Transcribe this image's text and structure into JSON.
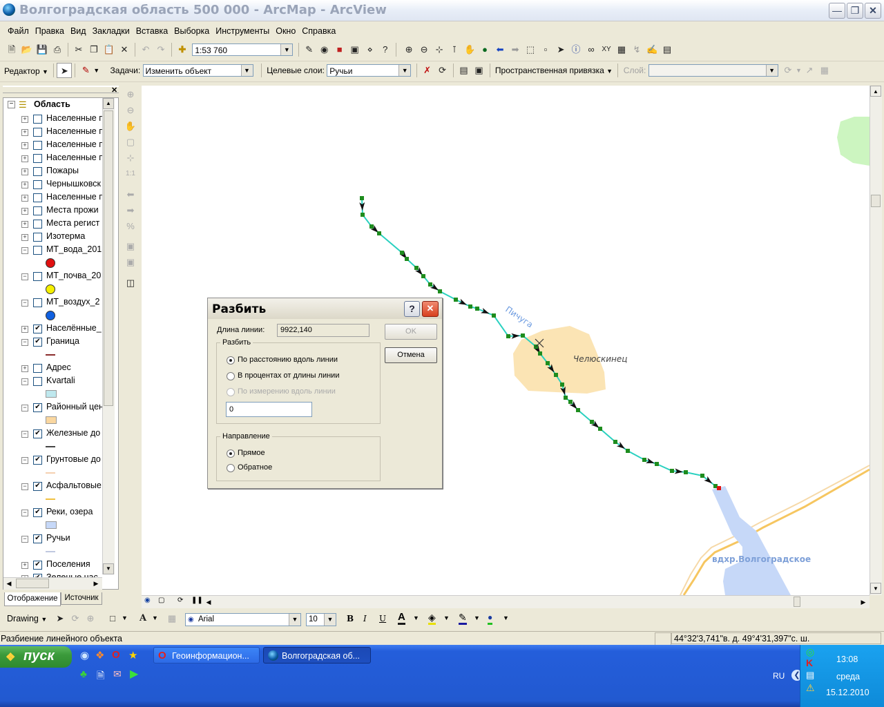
{
  "window": {
    "title": "Волгоградская область 500 000 - ArcMap - ArcView"
  },
  "menu": [
    "Файл",
    "Правка",
    "Вид",
    "Закладки",
    "Вставка",
    "Выборка",
    "Инструменты",
    "Окно",
    "Справка"
  ],
  "standard_toolbar": {
    "scale": "1:53 760"
  },
  "editor_toolbar": {
    "editor_label": "Редактор",
    "task_label": "Задачи:",
    "task_value": "Изменить объект",
    "target_label": "Целевые слои:",
    "target_value": "Ручьи",
    "snapping_label": "Пространственная привязка",
    "layer_label": "Слой:"
  },
  "toc": {
    "root": "Область",
    "layers": [
      {
        "label": "Населенные п",
        "checked": false,
        "expanded": false
      },
      {
        "label": "Населенные п",
        "checked": false,
        "expanded": false
      },
      {
        "label": "Населенные п",
        "checked": false,
        "expanded": false
      },
      {
        "label": "Населенные п",
        "checked": false,
        "expanded": false
      },
      {
        "label": "Пожары",
        "checked": false,
        "expanded": false
      },
      {
        "label": "Чернышковск",
        "checked": false,
        "expanded": false
      },
      {
        "label": "Населенные п",
        "checked": false,
        "expanded": false
      },
      {
        "label": "Места прожи",
        "checked": false,
        "expanded": false
      },
      {
        "label": "Места регист",
        "checked": false,
        "expanded": false
      },
      {
        "label": "Изотерма",
        "checked": false,
        "expanded": false
      },
      {
        "label": "МТ_вода_201",
        "checked": false,
        "expanded": true,
        "symbol": "circle",
        "color": "#e01010"
      },
      {
        "label": "МТ_почва_20",
        "checked": false,
        "expanded": true,
        "symbol": "circle",
        "color": "#f5f000"
      },
      {
        "label": "МТ_воздух_2",
        "checked": false,
        "expanded": true,
        "symbol": "circle",
        "color": "#1060e0"
      },
      {
        "label": "Населённые_",
        "checked": true,
        "expanded": false
      },
      {
        "label": "Граница",
        "checked": true,
        "expanded": true,
        "symbol": "line",
        "color": "#8a2b2b"
      },
      {
        "label": "Адрес",
        "checked": false,
        "expanded": false
      },
      {
        "label": "Kvartali",
        "checked": false,
        "expanded": true,
        "symbol": "rect",
        "color": "#bfe8ee"
      },
      {
        "label": "Районный цен",
        "checked": true,
        "expanded": true,
        "symbol": "rect",
        "color": "#fad7a0"
      },
      {
        "label": "Железные до",
        "checked": true,
        "expanded": true,
        "symbol": "line",
        "color": "#444444"
      },
      {
        "label": "Грунтовые до",
        "checked": true,
        "expanded": true,
        "symbol": "line",
        "color": "#f5d0b0"
      },
      {
        "label": "Асфальтовые",
        "checked": true,
        "expanded": true,
        "symbol": "line",
        "color": "#f0c040"
      },
      {
        "label": "Реки, озера",
        "checked": true,
        "expanded": true,
        "symbol": "rect",
        "color": "#c6d8f8"
      },
      {
        "label": "Ручьи",
        "checked": true,
        "expanded": true,
        "symbol": "line",
        "color": "#c0c8e0"
      },
      {
        "label": "Поселения",
        "checked": true,
        "expanded": false
      },
      {
        "label": "Зеленые нас",
        "checked": true,
        "expanded": false
      }
    ],
    "tabs": [
      "Отображение",
      "Источник"
    ]
  },
  "map": {
    "labels": {
      "stream": "Пичуга",
      "village": "Челюскинец",
      "reservoir": "вдхр.Волгоградское"
    },
    "colors": {
      "settlement": "#fbe4b4",
      "water": "#c6d8f8",
      "stream": "#2ad1c0",
      "road": "#f6c660",
      "green": "#ccf5c0",
      "vertex": "#1e8c1e",
      "end_vertex": "#e01010"
    }
  },
  "dialog": {
    "title": "Разбить",
    "length_label": "Длина линии:",
    "length_value": "9922,140",
    "ok": "OK",
    "cancel": "Отмена",
    "split_group": "Разбить",
    "options": [
      "По расстоянию вдоль линии",
      "В процентах от длины линии",
      "По измерению вдоль линии"
    ],
    "value": "0",
    "direction_group": "Направление",
    "directions": [
      "Прямое",
      "Обратное"
    ]
  },
  "drawing_toolbar": {
    "label": "Drawing",
    "font": "Arial",
    "size": "10",
    "bold": "B",
    "italic": "I",
    "underline": "U"
  },
  "status": {
    "message": "Разбиение линейного объекта",
    "coords": "44°32'3,741\"в. д.  49°4'31,397\"с. ш."
  },
  "taskbar": {
    "start": "пуск",
    "tasks": [
      "Геоинформацион...",
      "Волгоградская об..."
    ],
    "lang": "RU",
    "time": "13:08",
    "day": "среда",
    "date": "15.12.2010"
  }
}
